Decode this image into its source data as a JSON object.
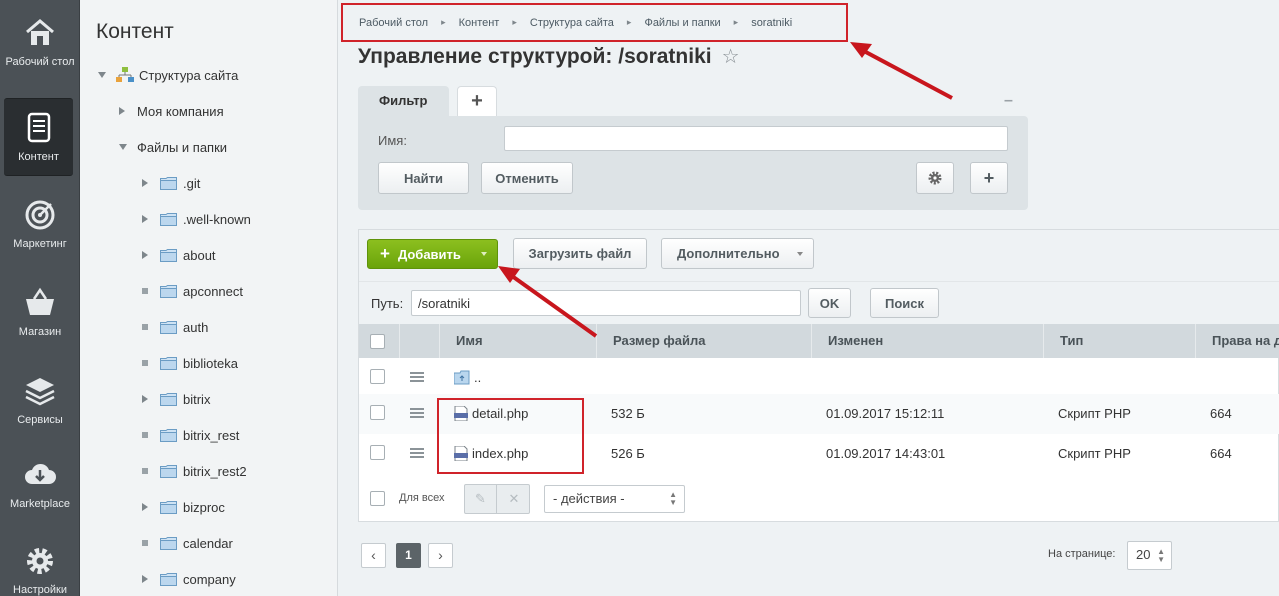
{
  "nav": [
    {
      "label": "Рабочий стол",
      "icon": "home-icon"
    },
    {
      "label": "Контент",
      "icon": "document-icon"
    },
    {
      "label": "Маркетинг",
      "icon": "target-icon"
    },
    {
      "label": "Магазин",
      "icon": "basket-icon"
    },
    {
      "label": "Сервисы",
      "icon": "layers-icon"
    },
    {
      "label": "Marketplace",
      "icon": "cloud-download-icon"
    },
    {
      "label": "Настройки",
      "icon": "gear-icon"
    }
  ],
  "tree": {
    "title": "Контент",
    "root": "Структура сайта",
    "company": "Моя компания",
    "files": "Файлы и папки",
    "folders": [
      ".git",
      ".well-known",
      "about",
      "apconnect",
      "auth",
      "biblioteka",
      "bitrix",
      "bitrix_rest",
      "bitrix_rest2",
      "bizproc",
      "calendar",
      "company"
    ]
  },
  "breadcrumb": [
    "Рабочий стол",
    "Контент",
    "Структура сайта",
    "Файлы и папки",
    "soratniki"
  ],
  "page_title": "Управление структурой: /soratniki",
  "filter": {
    "tab": "Фильтр",
    "add_tab": "+",
    "collapse": "–",
    "name_label": "Имя:",
    "name_value": "",
    "find": "Найти",
    "cancel": "Отменить"
  },
  "toolbar": {
    "add": "Добавить",
    "upload": "Загрузить файл",
    "more": "Дополнительно"
  },
  "path": {
    "label": "Путь:",
    "value": "/soratniki",
    "ok": "OK",
    "search": "Поиск"
  },
  "columns": [
    "Имя",
    "Размер файла",
    "Изменен",
    "Тип",
    "Права на д"
  ],
  "rows": [
    {
      "name": "..",
      "size": "",
      "modified": "",
      "type": "",
      "rights": ""
    },
    {
      "name": "detail.php",
      "size": "532 Б",
      "modified": "01.09.2017 15:12:11",
      "type": "Скрипт PHP",
      "rights": "664"
    },
    {
      "name": "index.php",
      "size": "526 Б",
      "modified": "01.09.2017 14:43:01",
      "type": "Скрипт PHP",
      "rights": "664"
    }
  ],
  "footer": {
    "for_all": "Для всех",
    "actions": "- действия -"
  },
  "pager": {
    "current": "1",
    "per_page_label": "На странице:",
    "per_page": "20"
  },
  "colors": {
    "accent_green": "#7ab315",
    "highlight_red": "#d0232a",
    "nav_bg": "#4b5156"
  }
}
